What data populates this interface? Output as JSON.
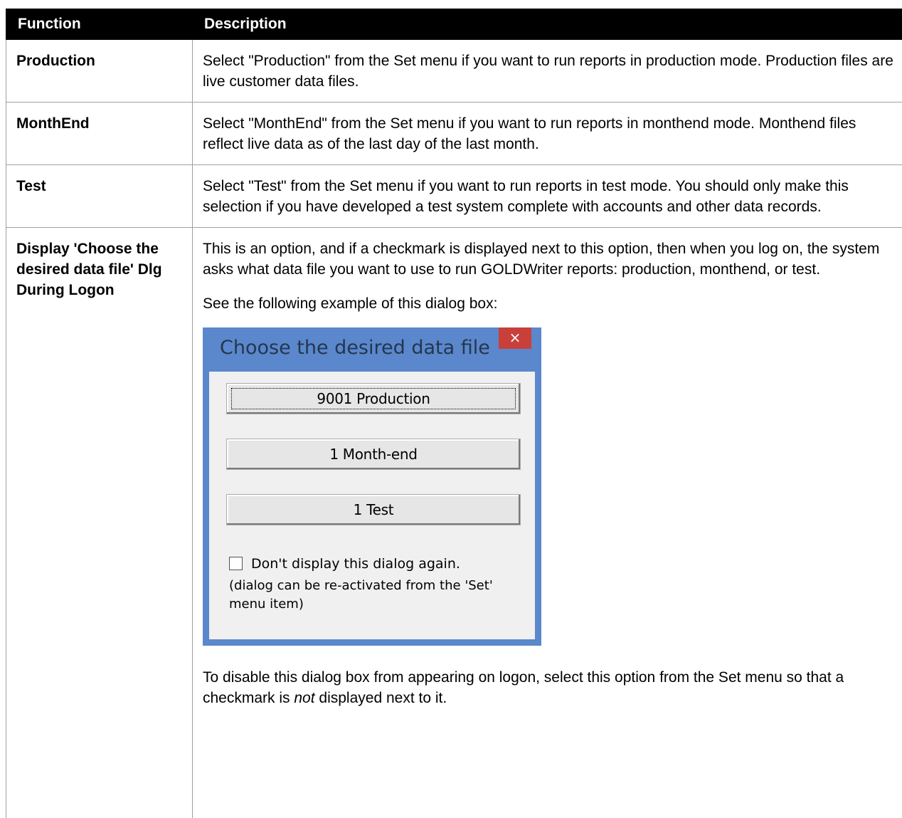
{
  "table": {
    "headers": {
      "function": "Function",
      "description": "Description"
    },
    "rows": [
      {
        "function": "Production",
        "description": "Select \"Production\" from the Set menu if you want to run reports in production mode. Production files are live customer data files."
      },
      {
        "function": "MonthEnd",
        "description": "Select \"MonthEnd\" from the Set menu if you want to run reports in monthend mode. Monthend files reflect live data as of the last day of the last month."
      },
      {
        "function": "Test",
        "description": "Select \"Test\" from the Set menu if you want to run reports in test mode.  You should only make this selection if you have developed a test system complete with accounts and other data records."
      },
      {
        "function": "Display 'Choose the desired data file' Dlg During Logon",
        "description_1": "This is an option, and if a checkmark is displayed next to this option, then when you log on, the system asks what data file you want to use to run GOLDWriter reports: production, monthend, or test.",
        "description_2": "See the following example of this dialog box:",
        "description_3_before": "To disable this dialog box from appearing on logon, select this option from the Set menu so that a checkmark is ",
        "description_3_em": "not",
        "description_3_after": " displayed next to it."
      }
    ]
  },
  "dialog": {
    "title": "Choose the desired data file",
    "close_glyph": "×",
    "buttons": [
      "9001 Production",
      "1 Month-end",
      "1 Test"
    ],
    "checkbox_label": "Don't display this dialog again.",
    "checkbox_checked": false,
    "note": "(dialog can be re-activated from the 'Set' menu item)",
    "frame_color": "#5b87cc",
    "close_color": "#c9403a"
  }
}
